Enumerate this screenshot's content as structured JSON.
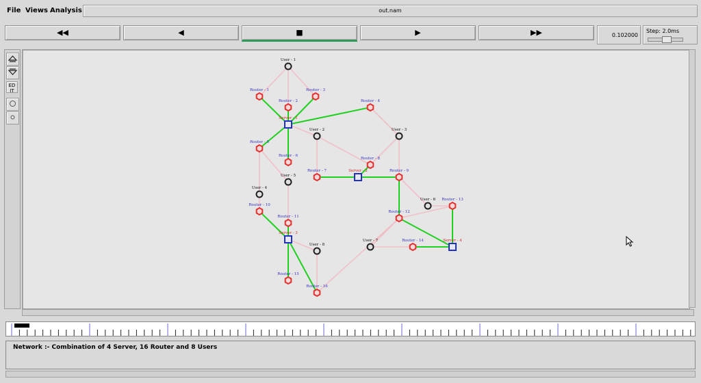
{
  "menu": {
    "file": "File",
    "views": "Views",
    "analysis": "Analysis"
  },
  "window": {
    "title": "out.nam"
  },
  "controls": {
    "rewind_fast": "◀◀",
    "rewind": "◀",
    "stop": "■",
    "play": "▶",
    "forward_fast": "▶▶",
    "time": "0.102000",
    "step": "Step: 2.0ms"
  },
  "toolbar": {
    "edit": "ED IT"
  },
  "status": {
    "text": "Network :- Combination of 4 Server, 16 Router and 8 Users"
  },
  "colors": {
    "router": "#e03030",
    "server": "#2030c0",
    "user": "#202020",
    "active_link": "#20d020",
    "idle_link": "#f0c0c8",
    "router_label": "#3030c0",
    "user_label": "#000000",
    "server_label": "#d02020"
  },
  "network": {
    "nodes": [
      {
        "id": "user1",
        "type": "user",
        "label": "User - 1"
      },
      {
        "id": "r1",
        "type": "router",
        "label": "Router - 1"
      },
      {
        "id": "r2",
        "type": "router",
        "label": "Router - 2"
      },
      {
        "id": "r3",
        "type": "router",
        "label": "Router - 3"
      },
      {
        "id": "r4",
        "type": "router",
        "label": "Router - 4"
      },
      {
        "id": "s1",
        "type": "server",
        "label": "Server - 1"
      },
      {
        "id": "user2",
        "type": "user",
        "label": "User - 2"
      },
      {
        "id": "user3",
        "type": "user",
        "label": "User - 3"
      },
      {
        "id": "r5",
        "type": "router",
        "label": "Router - 5"
      },
      {
        "id": "r6",
        "type": "router",
        "label": "Router - 6"
      },
      {
        "id": "r7",
        "type": "router",
        "label": "Router - 7"
      },
      {
        "id": "r8",
        "type": "router",
        "label": "Router - 8"
      },
      {
        "id": "s2",
        "type": "server",
        "label": "Server - 2"
      },
      {
        "id": "r9",
        "type": "router",
        "label": "Router - 9"
      },
      {
        "id": "user4",
        "type": "user",
        "label": "User - 4"
      },
      {
        "id": "user5",
        "type": "user",
        "label": "User - 5"
      },
      {
        "id": "r10",
        "type": "router",
        "label": "Router - 10"
      },
      {
        "id": "r11",
        "type": "router",
        "label": "Router - 11"
      },
      {
        "id": "s3",
        "type": "server",
        "label": "Server - 3"
      },
      {
        "id": "user6",
        "type": "user",
        "label": "User - 6"
      },
      {
        "id": "r13",
        "type": "router",
        "label": "Router - 13"
      },
      {
        "id": "r12",
        "type": "router",
        "label": "Router - 12"
      },
      {
        "id": "user7",
        "type": "user",
        "label": "User - 7"
      },
      {
        "id": "r14",
        "type": "router",
        "label": "Router - 14"
      },
      {
        "id": "s4",
        "type": "server",
        "label": "Server - 4"
      },
      {
        "id": "user8",
        "type": "user",
        "label": "User - 8"
      },
      {
        "id": "r15",
        "type": "router",
        "label": "Router - 15"
      },
      {
        "id": "r16",
        "type": "router",
        "label": "Router - 16"
      }
    ],
    "links": [
      {
        "from": "user1",
        "to": "r1",
        "active": false
      },
      {
        "from": "user1",
        "to": "r3",
        "active": false
      },
      {
        "from": "user1",
        "to": "r2",
        "active": false
      },
      {
        "from": "r1",
        "to": "s1",
        "active": true
      },
      {
        "from": "r2",
        "to": "s1",
        "active": true
      },
      {
        "from": "r3",
        "to": "s1",
        "active": true
      },
      {
        "from": "r4",
        "to": "s1",
        "active": true
      },
      {
        "from": "s1",
        "to": "r5",
        "active": true
      },
      {
        "from": "s1",
        "to": "r6",
        "active": true
      },
      {
        "from": "s1",
        "to": "user2",
        "active": false
      },
      {
        "from": "user2",
        "to": "r8",
        "active": false
      },
      {
        "from": "user2",
        "to": "r7",
        "active": false
      },
      {
        "from": "r4",
        "to": "user3",
        "active": false
      },
      {
        "from": "user3",
        "to": "r8",
        "active": false
      },
      {
        "from": "user3",
        "to": "r9",
        "active": false
      },
      {
        "from": "r7",
        "to": "s2",
        "active": true
      },
      {
        "from": "r8",
        "to": "s2",
        "active": true
      },
      {
        "from": "s2",
        "to": "r9",
        "active": true
      },
      {
        "from": "r5",
        "to": "user4",
        "active": false
      },
      {
        "from": "r5",
        "to": "user5",
        "active": false
      },
      {
        "from": "user4",
        "to": "r10",
        "active": false
      },
      {
        "from": "user5",
        "to": "r11",
        "active": false
      },
      {
        "from": "r10",
        "to": "s3",
        "active": true
      },
      {
        "from": "r11",
        "to": "s3",
        "active": true
      },
      {
        "from": "s3",
        "to": "r15",
        "active": true
      },
      {
        "from": "s3",
        "to": "r16",
        "active": true
      },
      {
        "from": "s3",
        "to": "user8",
        "active": false
      },
      {
        "from": "user8",
        "to": "r16",
        "active": false
      },
      {
        "from": "r16",
        "to": "r12",
        "active": false
      },
      {
        "from": "r9",
        "to": "r12",
        "active": true
      },
      {
        "from": "r9",
        "to": "user6",
        "active": false
      },
      {
        "from": "user6",
        "to": "r13",
        "active": false
      },
      {
        "from": "r12",
        "to": "r13",
        "active": false
      },
      {
        "from": "r13",
        "to": "s4",
        "active": true
      },
      {
        "from": "r12",
        "to": "s4",
        "active": true
      },
      {
        "from": "r12",
        "to": "user7",
        "active": false
      },
      {
        "from": "user7",
        "to": "r14",
        "active": false
      },
      {
        "from": "r14",
        "to": "s4",
        "active": true
      }
    ]
  }
}
